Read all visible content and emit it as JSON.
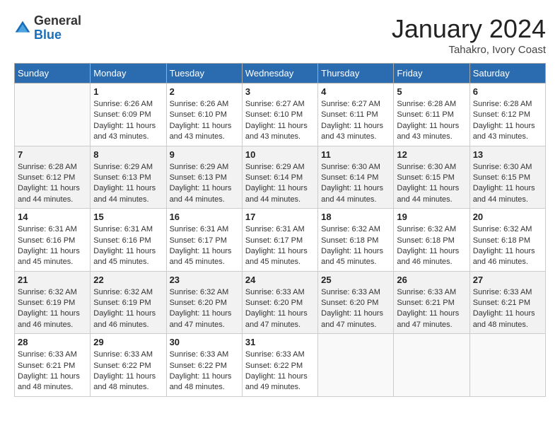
{
  "header": {
    "logo_general": "General",
    "logo_blue": "Blue",
    "month_year": "January 2024",
    "location": "Tahakro, Ivory Coast"
  },
  "weekdays": [
    "Sunday",
    "Monday",
    "Tuesday",
    "Wednesday",
    "Thursday",
    "Friday",
    "Saturday"
  ],
  "weeks": [
    [
      {
        "day": "",
        "sunrise": "",
        "sunset": "",
        "daylight": ""
      },
      {
        "day": "1",
        "sunrise": "Sunrise: 6:26 AM",
        "sunset": "Sunset: 6:09 PM",
        "daylight": "Daylight: 11 hours and 43 minutes."
      },
      {
        "day": "2",
        "sunrise": "Sunrise: 6:26 AM",
        "sunset": "Sunset: 6:10 PM",
        "daylight": "Daylight: 11 hours and 43 minutes."
      },
      {
        "day": "3",
        "sunrise": "Sunrise: 6:27 AM",
        "sunset": "Sunset: 6:10 PM",
        "daylight": "Daylight: 11 hours and 43 minutes."
      },
      {
        "day": "4",
        "sunrise": "Sunrise: 6:27 AM",
        "sunset": "Sunset: 6:11 PM",
        "daylight": "Daylight: 11 hours and 43 minutes."
      },
      {
        "day": "5",
        "sunrise": "Sunrise: 6:28 AM",
        "sunset": "Sunset: 6:11 PM",
        "daylight": "Daylight: 11 hours and 43 minutes."
      },
      {
        "day": "6",
        "sunrise": "Sunrise: 6:28 AM",
        "sunset": "Sunset: 6:12 PM",
        "daylight": "Daylight: 11 hours and 43 minutes."
      }
    ],
    [
      {
        "day": "7",
        "sunrise": "Sunrise: 6:28 AM",
        "sunset": "Sunset: 6:12 PM",
        "daylight": "Daylight: 11 hours and 44 minutes."
      },
      {
        "day": "8",
        "sunrise": "Sunrise: 6:29 AM",
        "sunset": "Sunset: 6:13 PM",
        "daylight": "Daylight: 11 hours and 44 minutes."
      },
      {
        "day": "9",
        "sunrise": "Sunrise: 6:29 AM",
        "sunset": "Sunset: 6:13 PM",
        "daylight": "Daylight: 11 hours and 44 minutes."
      },
      {
        "day": "10",
        "sunrise": "Sunrise: 6:29 AM",
        "sunset": "Sunset: 6:14 PM",
        "daylight": "Daylight: 11 hours and 44 minutes."
      },
      {
        "day": "11",
        "sunrise": "Sunrise: 6:30 AM",
        "sunset": "Sunset: 6:14 PM",
        "daylight": "Daylight: 11 hours and 44 minutes."
      },
      {
        "day": "12",
        "sunrise": "Sunrise: 6:30 AM",
        "sunset": "Sunset: 6:15 PM",
        "daylight": "Daylight: 11 hours and 44 minutes."
      },
      {
        "day": "13",
        "sunrise": "Sunrise: 6:30 AM",
        "sunset": "Sunset: 6:15 PM",
        "daylight": "Daylight: 11 hours and 44 minutes."
      }
    ],
    [
      {
        "day": "14",
        "sunrise": "Sunrise: 6:31 AM",
        "sunset": "Sunset: 6:16 PM",
        "daylight": "Daylight: 11 hours and 45 minutes."
      },
      {
        "day": "15",
        "sunrise": "Sunrise: 6:31 AM",
        "sunset": "Sunset: 6:16 PM",
        "daylight": "Daylight: 11 hours and 45 minutes."
      },
      {
        "day": "16",
        "sunrise": "Sunrise: 6:31 AM",
        "sunset": "Sunset: 6:17 PM",
        "daylight": "Daylight: 11 hours and 45 minutes."
      },
      {
        "day": "17",
        "sunrise": "Sunrise: 6:31 AM",
        "sunset": "Sunset: 6:17 PM",
        "daylight": "Daylight: 11 hours and 45 minutes."
      },
      {
        "day": "18",
        "sunrise": "Sunrise: 6:32 AM",
        "sunset": "Sunset: 6:18 PM",
        "daylight": "Daylight: 11 hours and 45 minutes."
      },
      {
        "day": "19",
        "sunrise": "Sunrise: 6:32 AM",
        "sunset": "Sunset: 6:18 PM",
        "daylight": "Daylight: 11 hours and 46 minutes."
      },
      {
        "day": "20",
        "sunrise": "Sunrise: 6:32 AM",
        "sunset": "Sunset: 6:18 PM",
        "daylight": "Daylight: 11 hours and 46 minutes."
      }
    ],
    [
      {
        "day": "21",
        "sunrise": "Sunrise: 6:32 AM",
        "sunset": "Sunset: 6:19 PM",
        "daylight": "Daylight: 11 hours and 46 minutes."
      },
      {
        "day": "22",
        "sunrise": "Sunrise: 6:32 AM",
        "sunset": "Sunset: 6:19 PM",
        "daylight": "Daylight: 11 hours and 46 minutes."
      },
      {
        "day": "23",
        "sunrise": "Sunrise: 6:32 AM",
        "sunset": "Sunset: 6:20 PM",
        "daylight": "Daylight: 11 hours and 47 minutes."
      },
      {
        "day": "24",
        "sunrise": "Sunrise: 6:33 AM",
        "sunset": "Sunset: 6:20 PM",
        "daylight": "Daylight: 11 hours and 47 minutes."
      },
      {
        "day": "25",
        "sunrise": "Sunrise: 6:33 AM",
        "sunset": "Sunset: 6:20 PM",
        "daylight": "Daylight: 11 hours and 47 minutes."
      },
      {
        "day": "26",
        "sunrise": "Sunrise: 6:33 AM",
        "sunset": "Sunset: 6:21 PM",
        "daylight": "Daylight: 11 hours and 47 minutes."
      },
      {
        "day": "27",
        "sunrise": "Sunrise: 6:33 AM",
        "sunset": "Sunset: 6:21 PM",
        "daylight": "Daylight: 11 hours and 48 minutes."
      }
    ],
    [
      {
        "day": "28",
        "sunrise": "Sunrise: 6:33 AM",
        "sunset": "Sunset: 6:21 PM",
        "daylight": "Daylight: 11 hours and 48 minutes."
      },
      {
        "day": "29",
        "sunrise": "Sunrise: 6:33 AM",
        "sunset": "Sunset: 6:22 PM",
        "daylight": "Daylight: 11 hours and 48 minutes."
      },
      {
        "day": "30",
        "sunrise": "Sunrise: 6:33 AM",
        "sunset": "Sunset: 6:22 PM",
        "daylight": "Daylight: 11 hours and 48 minutes."
      },
      {
        "day": "31",
        "sunrise": "Sunrise: 6:33 AM",
        "sunset": "Sunset: 6:22 PM",
        "daylight": "Daylight: 11 hours and 49 minutes."
      },
      {
        "day": "",
        "sunrise": "",
        "sunset": "",
        "daylight": ""
      },
      {
        "day": "",
        "sunrise": "",
        "sunset": "",
        "daylight": ""
      },
      {
        "day": "",
        "sunrise": "",
        "sunset": "",
        "daylight": ""
      }
    ]
  ]
}
